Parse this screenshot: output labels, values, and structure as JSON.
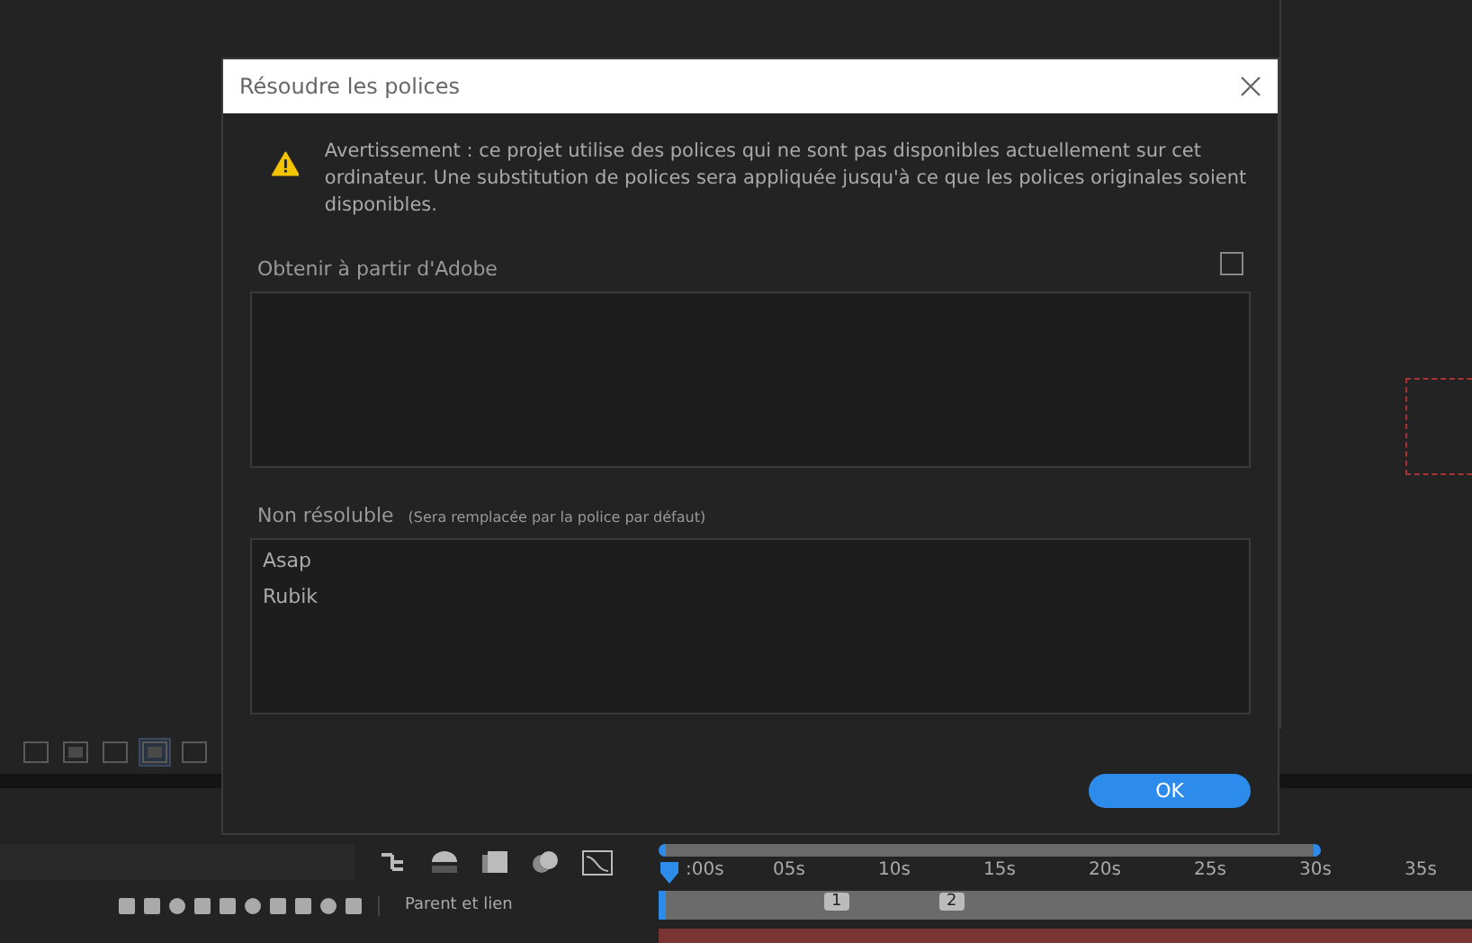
{
  "dialog": {
    "title": "Résoudre les polices",
    "warning": "Avertissement : ce projet utilise des polices qui ne sont pas disponibles actuellement sur cet ordinateur. Une substitution de polices sera appliquée jusqu'à ce que les polices originales soient disponibles.",
    "sections": [
      {
        "label": "Obtenir à partir d'Adobe",
        "checkbox": {
          "checked": false
        }
      },
      {
        "label": "Non résoluble",
        "note": "(Sera remplacée par la police par défaut)",
        "items": [
          "Asap",
          "Rubik"
        ]
      }
    ],
    "ok_button": "OK"
  },
  "timeline": {
    "column_header": "Parent et lien",
    "ticks": [
      ":00s",
      "05s",
      "10s",
      "15s",
      "20s",
      "25s",
      "30s",
      "35s"
    ],
    "markers": [
      "1",
      "2"
    ]
  }
}
